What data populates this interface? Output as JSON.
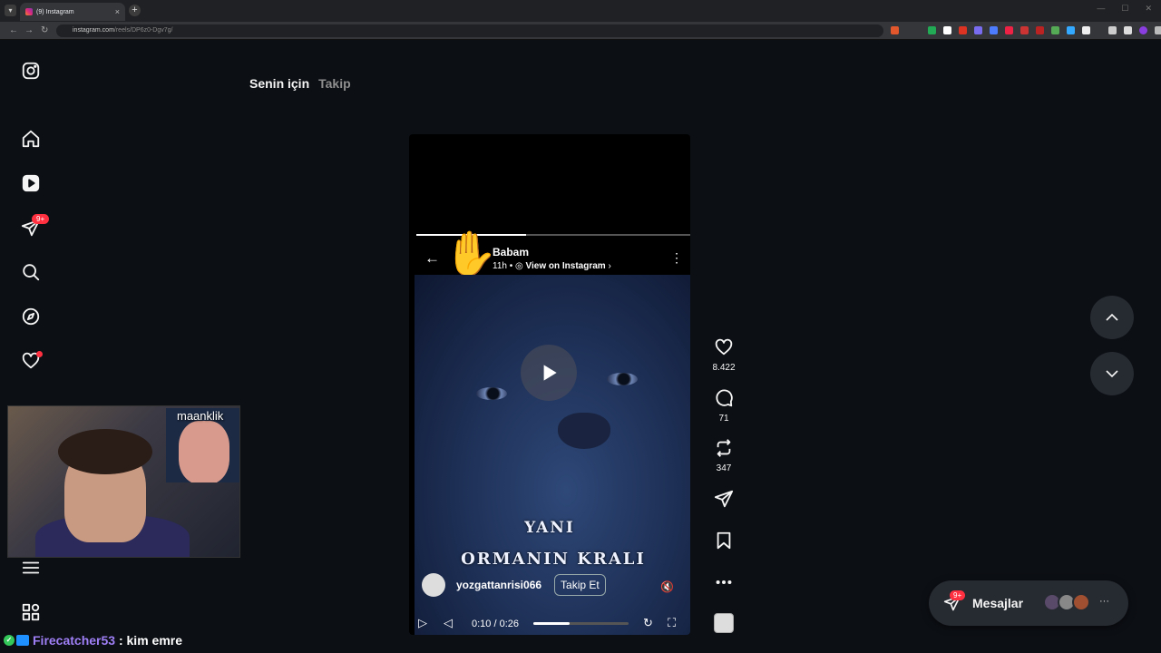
{
  "browser": {
    "tab_title": "(9) Instagram",
    "tab_close": "×",
    "new_tab": "+",
    "tab_list": "▾",
    "url_host": "instagram.com",
    "url_path": "/reels/DP6z0-Dgv7g/"
  },
  "sidebar": {
    "notif_badge": "9+"
  },
  "feed_tabs": [
    {
      "label": "Senin için"
    },
    {
      "label": "Takip"
    }
  ],
  "reel": {
    "header_title": "Babam",
    "time_ago": "11h",
    "view_on": "View on Instagram",
    "view_on_chevron": "›",
    "back_arrow": "←",
    "more_dots": "⋮",
    "hand_emoji": "✋",
    "caption_line1": "YANI",
    "caption_line2": "ORMANIN KRALI",
    "author": "yozgattanrisi066",
    "follow_label": "Takip Et",
    "mute_glyph": "🔇",
    "time_display": "0:10 / 0:26",
    "playback_progress": 0.38,
    "top_progress": 0.4
  },
  "actions": {
    "likes": "8.422",
    "comments": "71",
    "reposts": "347"
  },
  "messages": {
    "label": "Mesajlar",
    "badge": "9+",
    "more": "···"
  },
  "stream_overlay": {
    "cam_name": "maanklik",
    "chat_user": "Firecatcher53",
    "chat_sep": " : ",
    "chat_text": "kim emre"
  }
}
